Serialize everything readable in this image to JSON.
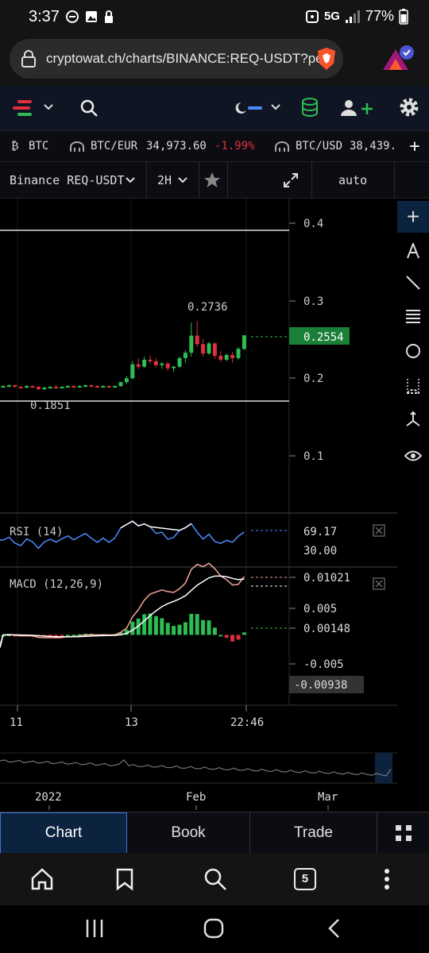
{
  "status": {
    "time": "3:37",
    "network": "5G",
    "battery": "77%"
  },
  "browser": {
    "url": "cryptowat.ch/charts/BINANCE:REQ-USDT?per",
    "tab_count": "5"
  },
  "ticker": [
    {
      "label": "BTC"
    },
    {
      "label": "BTC/EUR",
      "price": "34,973.60",
      "change": "-1.99%"
    },
    {
      "label": "BTC/USD",
      "price": "38,439."
    }
  ],
  "chart_toolbar": {
    "market": "Binance REQ-USDT",
    "interval": "2H",
    "scale": "auto"
  },
  "price_axis": {
    "ticks": [
      "0.4",
      "0.3",
      "0.2",
      "0.1"
    ],
    "current_price": "0.2554",
    "high_label": "0.2736",
    "low_label": "0.1851"
  },
  "rsi": {
    "label": "RSI (14)",
    "value": "69.17",
    "level": "30.00"
  },
  "macd": {
    "label": "MACD (12,26,9)",
    "ticks": [
      "0.005",
      "-0.005"
    ],
    "macd_value": "0.01021",
    "hist_value": "0.00148",
    "min_value": "-0.00938"
  },
  "time_axis": [
    "11",
    "13",
    "22:46"
  ],
  "navigator_axis": [
    "2022",
    "Feb",
    "Mar"
  ],
  "bottom_tabs": {
    "chart": "Chart",
    "book": "Book",
    "trade": "Trade"
  },
  "colors": {
    "up": "#2ebd55",
    "down": "#e0303f",
    "rsi": "#4a8cff",
    "accent": "#3b74d8"
  },
  "chart_data": {
    "type": "candlestick",
    "interval": "2H",
    "price_range": [
      0.06,
      0.43
    ],
    "high": 0.2736,
    "low": 0.1851,
    "last": 0.2554,
    "rsi_last": 69.17,
    "macd_last": 0.01021,
    "histogram_last": 0.00148,
    "macd_range": [
      -0.00938,
      0.01021
    ],
    "candles": [
      [
        0.189,
        0.191,
        0.188,
        0.19
      ],
      [
        0.19,
        0.192,
        0.189,
        0.191
      ],
      [
        0.191,
        0.192,
        0.188,
        0.189
      ],
      [
        0.189,
        0.19,
        0.187,
        0.188
      ],
      [
        0.188,
        0.191,
        0.187,
        0.19
      ],
      [
        0.19,
        0.191,
        0.188,
        0.189
      ],
      [
        0.189,
        0.19,
        0.185,
        0.186
      ],
      [
        0.186,
        0.189,
        0.185,
        0.188
      ],
      [
        0.188,
        0.19,
        0.187,
        0.189
      ],
      [
        0.189,
        0.191,
        0.188,
        0.188
      ],
      [
        0.188,
        0.19,
        0.187,
        0.189
      ],
      [
        0.189,
        0.191,
        0.188,
        0.19
      ],
      [
        0.19,
        0.191,
        0.188,
        0.189
      ],
      [
        0.189,
        0.191,
        0.188,
        0.19
      ],
      [
        0.19,
        0.192,
        0.189,
        0.191
      ],
      [
        0.191,
        0.192,
        0.189,
        0.19
      ],
      [
        0.19,
        0.191,
        0.188,
        0.189
      ],
      [
        0.189,
        0.191,
        0.188,
        0.19
      ],
      [
        0.19,
        0.191,
        0.188,
        0.189
      ],
      [
        0.189,
        0.191,
        0.188,
        0.19
      ],
      [
        0.19,
        0.196,
        0.189,
        0.195
      ],
      [
        0.195,
        0.203,
        0.193,
        0.2
      ],
      [
        0.2,
        0.222,
        0.199,
        0.218
      ],
      [
        0.218,
        0.226,
        0.212,
        0.215
      ],
      [
        0.215,
        0.228,
        0.213,
        0.224
      ],
      [
        0.224,
        0.229,
        0.219,
        0.222
      ],
      [
        0.222,
        0.226,
        0.214,
        0.217
      ],
      [
        0.217,
        0.221,
        0.212,
        0.219
      ],
      [
        0.219,
        0.221,
        0.21,
        0.213
      ],
      [
        0.213,
        0.216,
        0.208,
        0.215
      ],
      [
        0.215,
        0.228,
        0.213,
        0.226
      ],
      [
        0.226,
        0.236,
        0.22,
        0.233
      ],
      [
        0.233,
        0.272,
        0.228,
        0.255
      ],
      [
        0.255,
        0.2736,
        0.24,
        0.244
      ],
      [
        0.244,
        0.251,
        0.228,
        0.232
      ],
      [
        0.232,
        0.247,
        0.23,
        0.245
      ],
      [
        0.245,
        0.246,
        0.225,
        0.229
      ],
      [
        0.229,
        0.235,
        0.221,
        0.224
      ],
      [
        0.224,
        0.232,
        0.222,
        0.23
      ],
      [
        0.23,
        0.234,
        0.22,
        0.226
      ],
      [
        0.226,
        0.24,
        0.224,
        0.238
      ],
      [
        0.238,
        0.2556,
        0.236,
        0.2554
      ]
    ]
  }
}
